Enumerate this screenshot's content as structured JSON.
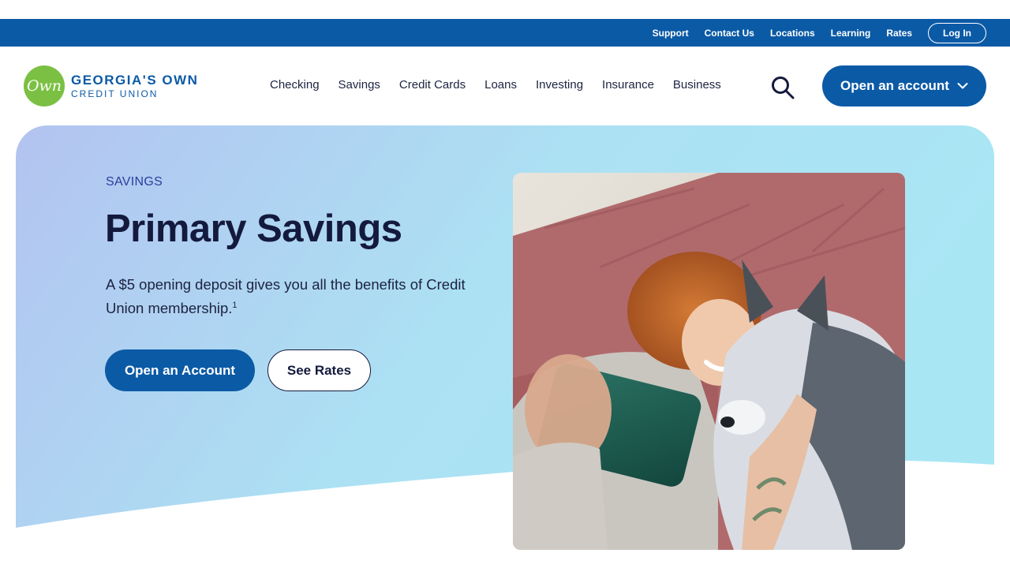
{
  "utility": {
    "links": [
      "Support",
      "Contact Us",
      "Locations",
      "Learning",
      "Rates"
    ],
    "login_label": "Log In"
  },
  "brand": {
    "logo_mark": "Own",
    "name_line1": "GEORGIA'S OWN",
    "name_line2": "CREDIT UNION"
  },
  "nav": {
    "items": [
      "Checking",
      "Savings",
      "Credit Cards",
      "Loans",
      "Investing",
      "Insurance",
      "Business"
    ],
    "search_icon": "search-icon",
    "open_account_label": "Open an account"
  },
  "hero": {
    "eyebrow": "SAVINGS",
    "title": "Primary Savings",
    "description": "A $5 opening deposit gives you all the benefits of Credit Union membership.",
    "footnote": "1",
    "primary_cta": "Open an Account",
    "secondary_cta": "See Rates"
  },
  "colors": {
    "brand_blue": "#0b5aa6",
    "logo_green": "#7bc043",
    "hero_gradient_start": "#b3c3f0",
    "hero_gradient_end": "#a9e6f4",
    "headline": "#141a3d"
  }
}
